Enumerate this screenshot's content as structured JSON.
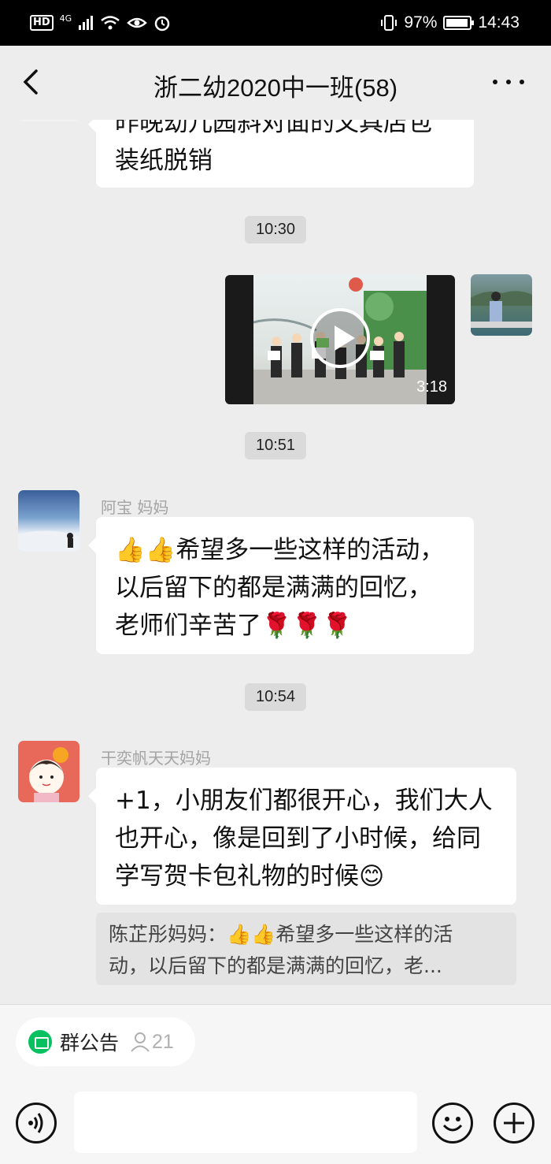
{
  "status_bar": {
    "hd": "HD",
    "network": "4G",
    "battery_percent": "97%",
    "battery_level": 0.97,
    "time": "14:43"
  },
  "header": {
    "title": "浙二幼2020中一班(58)",
    "back_icon": "back-arrow-icon",
    "more_icon": "more-dots-icon"
  },
  "messages": {
    "partial_message": {
      "line1": "昨晚幼儿园斜对面的文具店包",
      "line2": "装纸脱销"
    },
    "timestamp_1": "10:30",
    "video_message": {
      "duration": "3:18"
    },
    "timestamp_2": "10:51",
    "message_1": {
      "sender": "阿宝 妈妈",
      "line1": "希望多一些这样的活动，",
      "line2": "以后留下的都是满满的回忆，",
      "line3": "老师们辛苦了"
    },
    "timestamp_3": "10:54",
    "message_2": {
      "sender": "干奕帆天天妈妈",
      "line1": "+1，小朋友们都很开心，我们大人",
      "line2": "也开心，像是回到了小时候，给同",
      "line3": "学写贺卡包礼物的时候",
      "quote_line1": "陈芷彤妈妈：",
      "quote_line1b": "希望多一些这样的活",
      "quote_line2": "动，以后留下的都是满满的回忆，老..."
    }
  },
  "bottom_bar": {
    "notice_label": "群公告",
    "member_count": "21",
    "voice_icon": "voice-icon",
    "emoji_icon": "emoji-icon",
    "add_icon": "plus-icon"
  },
  "colors": {
    "accent_green": "#07c160",
    "chat_background": "#ededed"
  }
}
